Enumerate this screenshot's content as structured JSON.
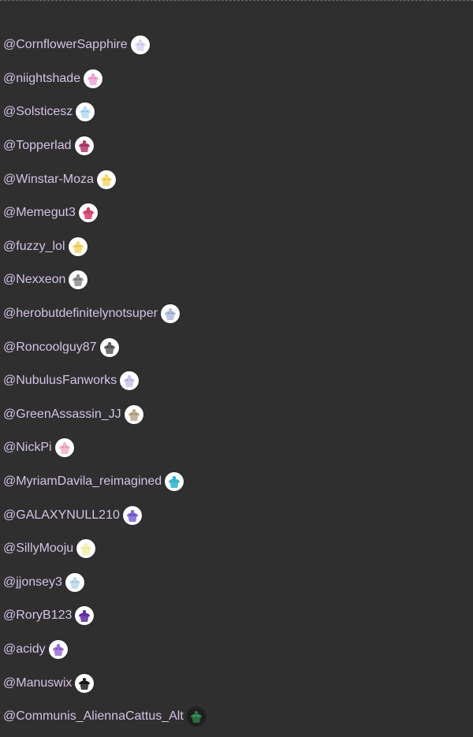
{
  "users": [
    {
      "handle": "@CornflowerSapphire",
      "avatar": {
        "name": "lavender-cupcake-avatar",
        "bg": "#ffffff",
        "color": "#ddd5f5",
        "accent": "#9b8fc9"
      }
    },
    {
      "handle": "@niightshade",
      "avatar": {
        "name": "pink-cupcake-avatar",
        "bg": "#ffffff",
        "color": "#f0a6d8",
        "accent": "#d85aa5"
      }
    },
    {
      "handle": "@Solsticesz",
      "avatar": {
        "name": "blue-cupcake-avatar",
        "bg": "#ffffff",
        "color": "#b6dbf5",
        "accent": "#5a9ac8"
      }
    },
    {
      "handle": "@Topperlad",
      "avatar": {
        "name": "magenta-cupcake-avatar",
        "bg": "#ffffff",
        "color": "#b43a68",
        "accent": "#6e1b3c"
      }
    },
    {
      "handle": "@Winstar-Moza",
      "avatar": {
        "name": "yellow-cupcake-avatar",
        "bg": "#ffffff",
        "color": "#f5d86c",
        "accent": "#c89b1e"
      }
    },
    {
      "handle": "@Memegut3",
      "avatar": {
        "name": "rainbow-cupcake-avatar",
        "bg": "#ffffff",
        "color": "#d83a6a",
        "accent": "#5cb85c"
      }
    },
    {
      "handle": "@fuzzy_lol",
      "avatar": {
        "name": "yellow-cupcake-avatar",
        "bg": "#ffffff",
        "color": "#f7d46a",
        "accent": "#c49a2b"
      }
    },
    {
      "handle": "@Nexxeon",
      "avatar": {
        "name": "gray-cupcake-avatar",
        "bg": "#ffffff",
        "color": "#8d8d8d",
        "accent": "#4a4a4a"
      }
    },
    {
      "handle": "@herobutdefinitelynotsuper",
      "avatar": {
        "name": "blue-gray-cupcake-avatar",
        "bg": "#ffffff",
        "color": "#aebddc",
        "accent": "#6a7aa0"
      }
    },
    {
      "handle": "@Roncoolguy87",
      "avatar": {
        "name": "dark-gray-cupcake-avatar",
        "bg": "#ffffff",
        "color": "#5d5d5d",
        "accent": "#2a2a2a"
      }
    },
    {
      "handle": "@NubulusFanworks",
      "avatar": {
        "name": "lavender-cupcake-avatar",
        "bg": "#ffffff",
        "color": "#c9c3ea",
        "accent": "#8a7fc4"
      }
    },
    {
      "handle": "@GreenAssassin_JJ",
      "avatar": {
        "name": "tan-cupcake-avatar",
        "bg": "#ffffff",
        "color": "#b9a98a",
        "accent": "#6e5e44"
      }
    },
    {
      "handle": "@NickPi",
      "avatar": {
        "name": "pink-cupcake-avatar",
        "bg": "#ffffff",
        "color": "#f3b1c9",
        "accent": "#c85a86"
      }
    },
    {
      "handle": "@MyriamDavila_reimagined",
      "avatar": {
        "name": "cupcake-icon-avatar",
        "bg": "#ffffff",
        "color": "#2bb3d8",
        "accent": "#f2b01e"
      }
    },
    {
      "handle": "@GALAXYNULL210",
      "avatar": {
        "name": "purple-cupcake-avatar",
        "bg": "#ffffff",
        "color": "#7a63d6",
        "accent": "#3c2b8a"
      }
    },
    {
      "handle": "@SillyMooju",
      "avatar": {
        "name": "pastel-cupcake-avatar",
        "bg": "#ffffff",
        "color": "#f3f0a6",
        "accent": "#a7d4ee"
      }
    },
    {
      "handle": "@jjonsey3",
      "avatar": {
        "name": "light-blue-cupcake-avatar",
        "bg": "#ffffff",
        "color": "#bcd9ee",
        "accent": "#6e9ec5"
      }
    },
    {
      "handle": "@RoryB123",
      "avatar": {
        "name": "purple-drop-avatar",
        "bg": "#ffffff",
        "color": "#5a2aa8",
        "accent": "#e53935"
      }
    },
    {
      "handle": "@acidy",
      "avatar": {
        "name": "purple-cupcake-avatar",
        "bg": "#ffffff",
        "color": "#9a6bd8",
        "accent": "#5a2a9e"
      }
    },
    {
      "handle": "@Manuswix",
      "avatar": {
        "name": "black-cupcake-avatar",
        "bg": "#ffffff",
        "color": "#1e1e1e",
        "accent": "#000000"
      }
    },
    {
      "handle": "@Communis_AliennaCattus_Alt",
      "avatar": {
        "name": "green-alien-cupcake-avatar",
        "bg": "#1f1f1f",
        "color": "#2a7a44",
        "accent": "#8ee86d"
      }
    }
  ]
}
